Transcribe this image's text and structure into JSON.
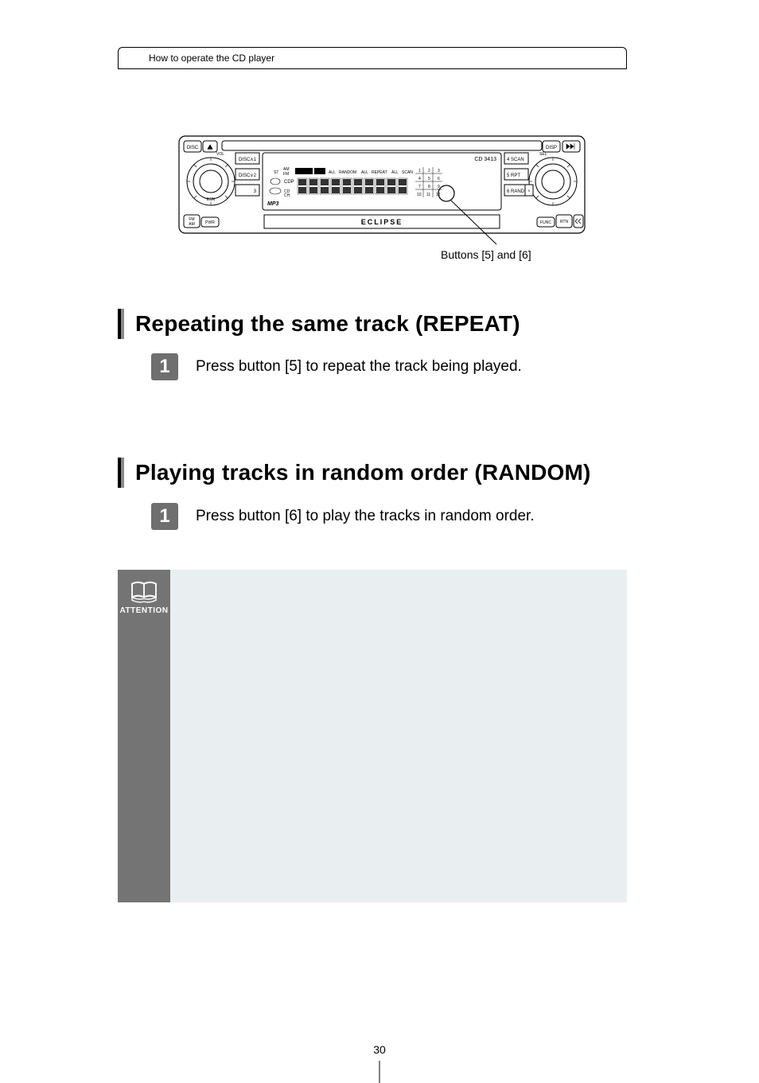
{
  "breadcrumb": "How to operate the CD player",
  "stereo": {
    "model": "CD 3413",
    "brand": "ECLIPSE",
    "left_buttons": [
      "DISC",
      "eject",
      "VOL",
      "FM/AM",
      "PWR"
    ],
    "left_preset_labels": [
      "DISC∧1",
      "DISC∨2",
      "3"
    ],
    "left_knob_label": "ESN",
    "right_buttons": [
      "DISP",
      "next",
      "SEL",
      "SET",
      "FUNC",
      "RTN",
      "prev"
    ],
    "right_preset_labels": [
      "4 SCAN",
      "5  RPT",
      "6 RAND"
    ],
    "display_icons": [
      "ST",
      "AM/FM",
      "DOLBY",
      "DISC",
      "ALL",
      "RANDOM",
      "ALL",
      "REPEAT",
      "ALL",
      "SCAN"
    ],
    "display_tracks": [
      "1",
      "2",
      "3",
      "4",
      "5",
      "6",
      "7",
      "8",
      "9",
      "10",
      "11",
      "12"
    ],
    "display_secondary": [
      "CDP",
      "CD/CH"
    ],
    "mp3_label": "MP3"
  },
  "figure_caption": "Buttons [5] and [6]",
  "sections": [
    {
      "title": "Repeating the same track (REPEAT)",
      "steps": [
        {
          "num": "1",
          "text": "Press button [5] to repeat the track being played."
        }
      ]
    },
    {
      "title": "Playing tracks in random order (RANDOM)",
      "steps": [
        {
          "num": "1",
          "text": "Press button [6] to play the tracks in random order."
        }
      ]
    }
  ],
  "attention_label": "ATTENTION",
  "page_number": "30"
}
